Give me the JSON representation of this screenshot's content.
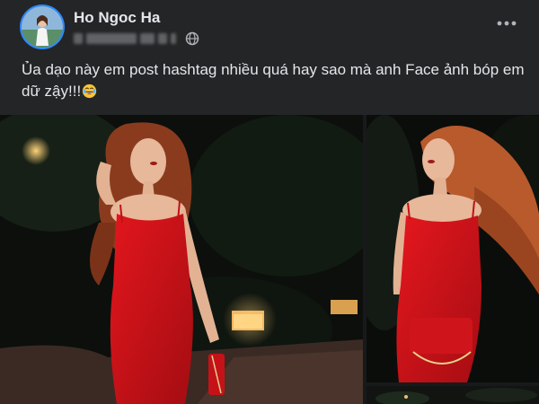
{
  "post": {
    "author": "Ho Ngoc Ha",
    "caption": "Ủa dạo này em post hashtag nhiều quá hay sao mà anh Face ảnh bóp em dữ zậy!!!",
    "caption_emoji": "laughing-tears-emoji",
    "privacy_icon": "globe-icon",
    "menu_icon": "more-options-icon"
  },
  "colors": {
    "background": "#242526",
    "text": "#e4e6eb",
    "accent": "#2d88ff",
    "dress": "#d0141b"
  },
  "photos": [
    {
      "name": "photo-woman-red-dress-walking"
    },
    {
      "name": "photo-woman-red-dress-hair-flip"
    },
    {
      "name": "photo-third-partial"
    }
  ]
}
